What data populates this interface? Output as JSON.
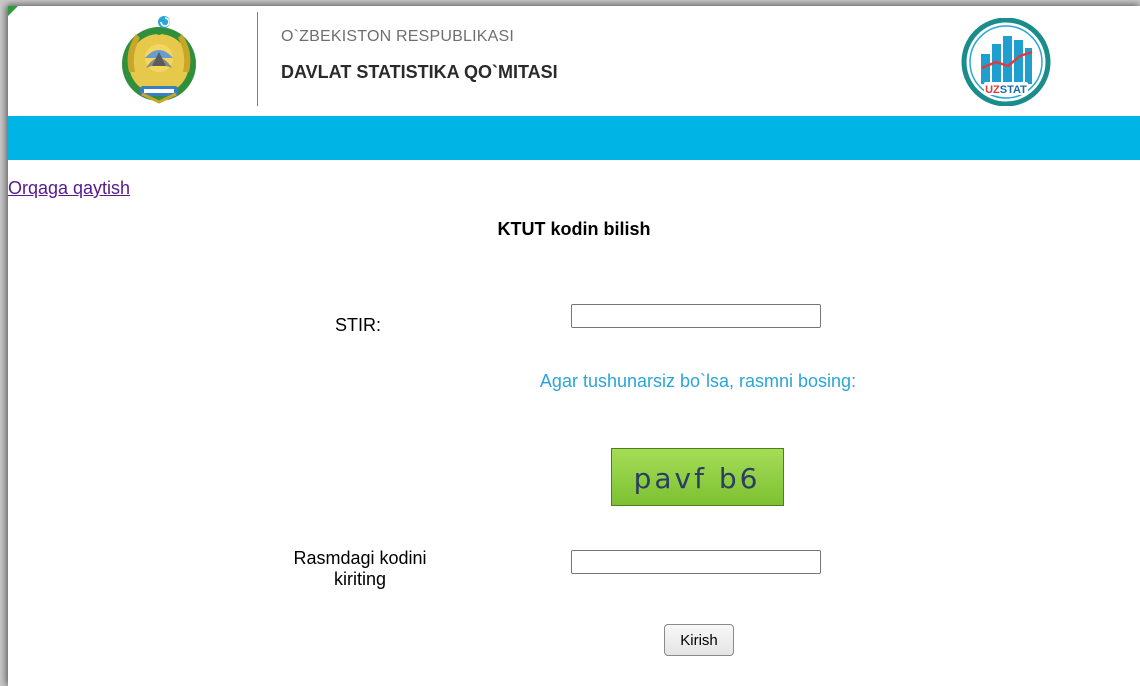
{
  "header": {
    "org_line1": "O`ZBEKISTON RESPUBLIKASI",
    "org_line2": "DAVLAT STATISTIKA QO`MITASI",
    "logo_text": "UZSTAT",
    "bar_color": "#00b4e6"
  },
  "nav": {
    "back_link": "Orqaga qaytish"
  },
  "form": {
    "title": "KTUT kodin bilish",
    "stir_label": "STIR:",
    "stir_value": "",
    "captcha_hint": "Agar tushunarsiz bo`lsa, rasmni bosing:",
    "captcha_text": "pavf b6",
    "code_label": "Rasmdagi kodini kiriting",
    "code_value": "",
    "submit_label": "Kirish"
  },
  "icons": {
    "emblem": "state-emblem-icon",
    "logo": "uzstat-logo-icon"
  }
}
